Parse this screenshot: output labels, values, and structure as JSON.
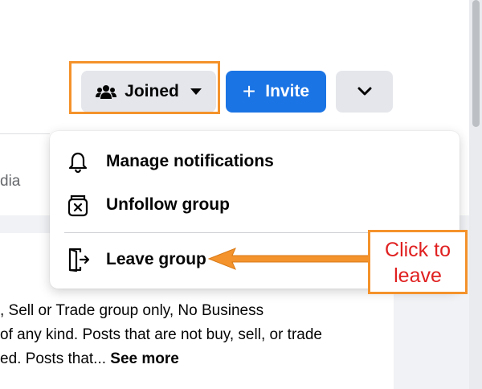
{
  "header": {
    "joined_label": "Joined",
    "invite_label": "Invite",
    "invite_plus": "+"
  },
  "left_panel": {
    "tab_fragment": "dia"
  },
  "menu": {
    "items": [
      {
        "label": "Manage notifications",
        "icon": "bell-icon"
      },
      {
        "label": "Unfollow group",
        "icon": "unfollow-icon"
      },
      {
        "label": "Leave group",
        "icon": "leave-door-icon"
      }
    ]
  },
  "about": {
    "line1": ", Sell or Trade group only, No Business",
    "line2": "of any kind. Posts that are not buy, sell, or trade",
    "line3_prefix": "ed. Posts that... ",
    "see_more": "See more"
  },
  "annotation": {
    "callout_line1": "Click to",
    "callout_line2": "leave",
    "highlight_color": "#f4922b",
    "callout_text_color": "#e02020"
  },
  "colors": {
    "primary": "#1b74e4",
    "button_gray": "#e4e6eb",
    "annotation_orange": "#f4922b"
  }
}
